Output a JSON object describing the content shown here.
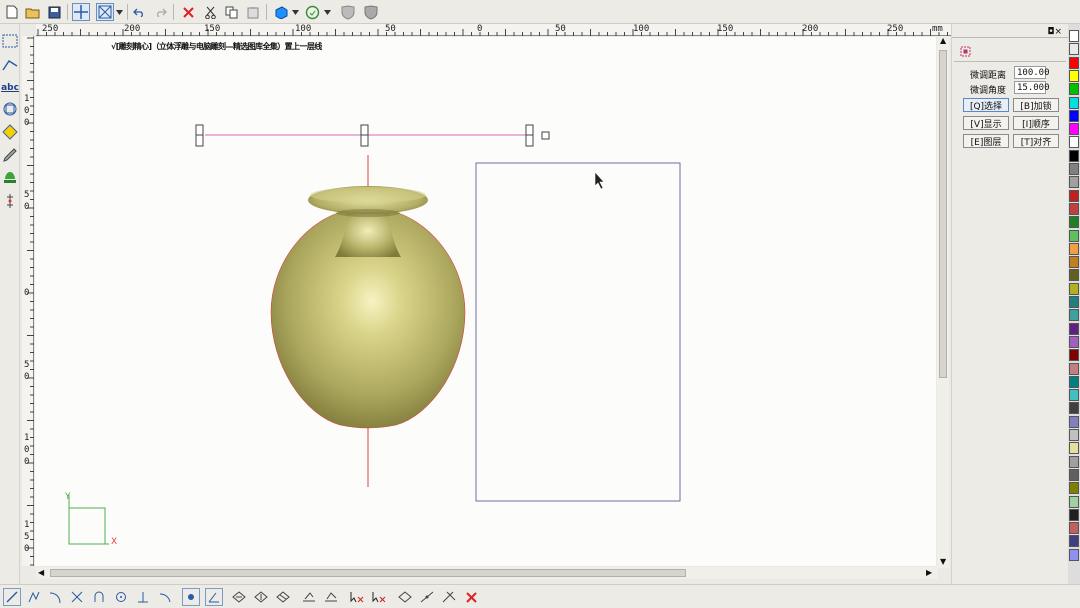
{
  "canvas": {
    "header_text": "√[雕刻精心]（立体浮雕与电脑雕刻—精选图库全集）置上一层线",
    "ruler_unit": "mm",
    "h_ruler_labels": [
      "250",
      "200",
      "150",
      "100",
      "50",
      "0",
      "50",
      "100",
      "150",
      "200",
      "250"
    ],
    "v_ruler_labels": [
      "1",
      "0",
      "0",
      "5",
      "0",
      "0",
      "5",
      "0",
      "1",
      "0",
      "0",
      "1",
      "5",
      "0"
    ],
    "axis_y_label": "Y",
    "axis_x_label": "X"
  },
  "right_panel": {
    "fine_distance_label": "微调距离",
    "fine_distance_value": "100.00",
    "fine_angle_label": "微调角度",
    "fine_angle_value": "15.000",
    "buttons": {
      "select": "[Q]选择",
      "lock": "[B]加锁",
      "show": "[V]显示",
      "order": "[I]顺序",
      "layer": "[E]图层",
      "align": "[T]对齐"
    },
    "window_controls": "◘×"
  },
  "colors": {
    "vase_main": "#b7b36a",
    "vase_highlight": "#f6f3c2",
    "vase_shadow": "#6f6c34",
    "guide_line": "#d96bb0",
    "axis_red": "#d44",
    "rect_border": "#6b6fa6",
    "axis_green": "#4caf50"
  },
  "palette": [
    "#ffffff",
    "#e8e8e8",
    "#ff0000",
    "#ffff00",
    "#00c000",
    "#00e0e0",
    "#0000ff",
    "#ff00ff",
    "#ffffff",
    "#000000",
    "#808080",
    "#a0a0a0",
    "#c02020",
    "#c04040",
    "#208020",
    "#60c060",
    "#f0a040",
    "#c08020",
    "#606020",
    "#b0b020",
    "#208080",
    "#40a0a0",
    "#602080",
    "#a060c0",
    "#800000",
    "#c08080",
    "#008080",
    "#40c0c0",
    "#404040",
    "#8080c0",
    "#c0c0c0",
    "#e0e0a0",
    "#a0a0a0",
    "#606060",
    "#808000",
    "#a0d0a0",
    "#202020",
    "#c06060",
    "#404080",
    "#9090f0"
  ]
}
